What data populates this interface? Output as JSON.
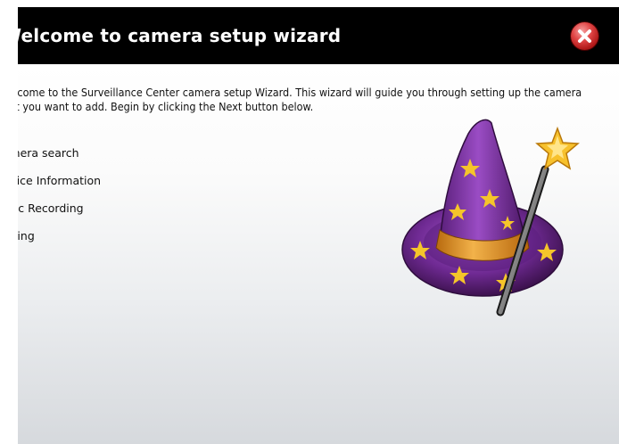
{
  "window": {
    "title": "Welcome to camera setup wizard",
    "close_icon": "close-x-icon",
    "header_color": "#000000",
    "close_color": "#d23232"
  },
  "intro": {
    "line1": "Welcome to the Surveillance Center camera setup Wizard. This wizard will guide you through setting up the camera",
    "line2": "that you want to add. Begin by clicking the Next button below."
  },
  "steps": [
    {
      "label": "Camera search"
    },
    {
      "label": "Device Information"
    },
    {
      "label": "Basic Recording"
    },
    {
      "label": "Setting"
    }
  ],
  "illustration": {
    "icon": "wizard-hat-and-wand-icon",
    "hat_color": "#7b2f9c",
    "band_color": "#e8951a",
    "star_color": "#f5c52a"
  }
}
